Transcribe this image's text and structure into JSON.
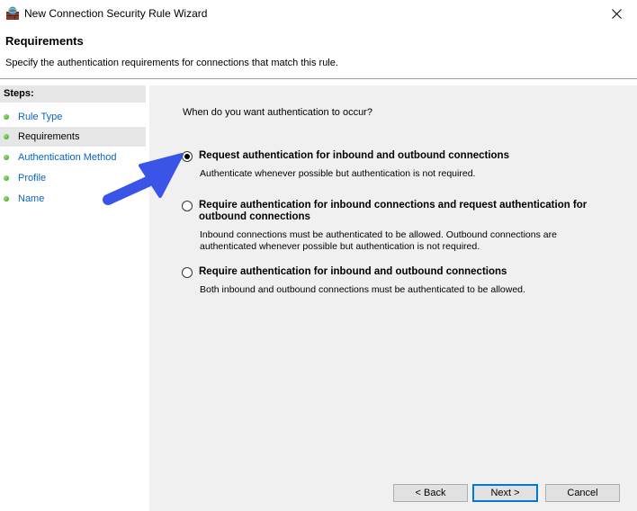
{
  "window": {
    "title": "New Connection Security Rule Wizard"
  },
  "header": {
    "title": "Requirements",
    "subtitle": "Specify the authentication requirements for connections that match this rule."
  },
  "sidebar": {
    "steps_label": "Steps:",
    "items": [
      {
        "label": "Rule Type"
      },
      {
        "label": "Requirements"
      },
      {
        "label": "Authentication Method"
      },
      {
        "label": "Profile"
      },
      {
        "label": "Name"
      }
    ]
  },
  "main": {
    "question": "When do you want authentication to occur?",
    "options": [
      {
        "label": "Request authentication for inbound and outbound connections",
        "description": "Authenticate whenever possible but authentication is not required.",
        "selected": true
      },
      {
        "label": "Require authentication for inbound connections and request authentication for outbound connections",
        "description": "Inbound connections must be authenticated to be allowed. Outbound connections are authenticated whenever possible but authentication is not required.",
        "selected": false
      },
      {
        "label": "Require authentication for inbound and outbound connections",
        "description": "Both inbound and outbound connections must be authenticated to be allowed.",
        "selected": false
      }
    ]
  },
  "buttons": {
    "back": "< Back",
    "next": "Next >",
    "cancel": "Cancel"
  },
  "colors": {
    "accent": "#0078d7",
    "link": "#0a63c2",
    "arrow": "#3a54e8",
    "step_dot": "#2f9e1e"
  },
  "icons": {
    "app": "firewall-icon",
    "close": "close-icon",
    "step": "green-dot-icon",
    "annotation": "pointer-arrow-icon"
  }
}
